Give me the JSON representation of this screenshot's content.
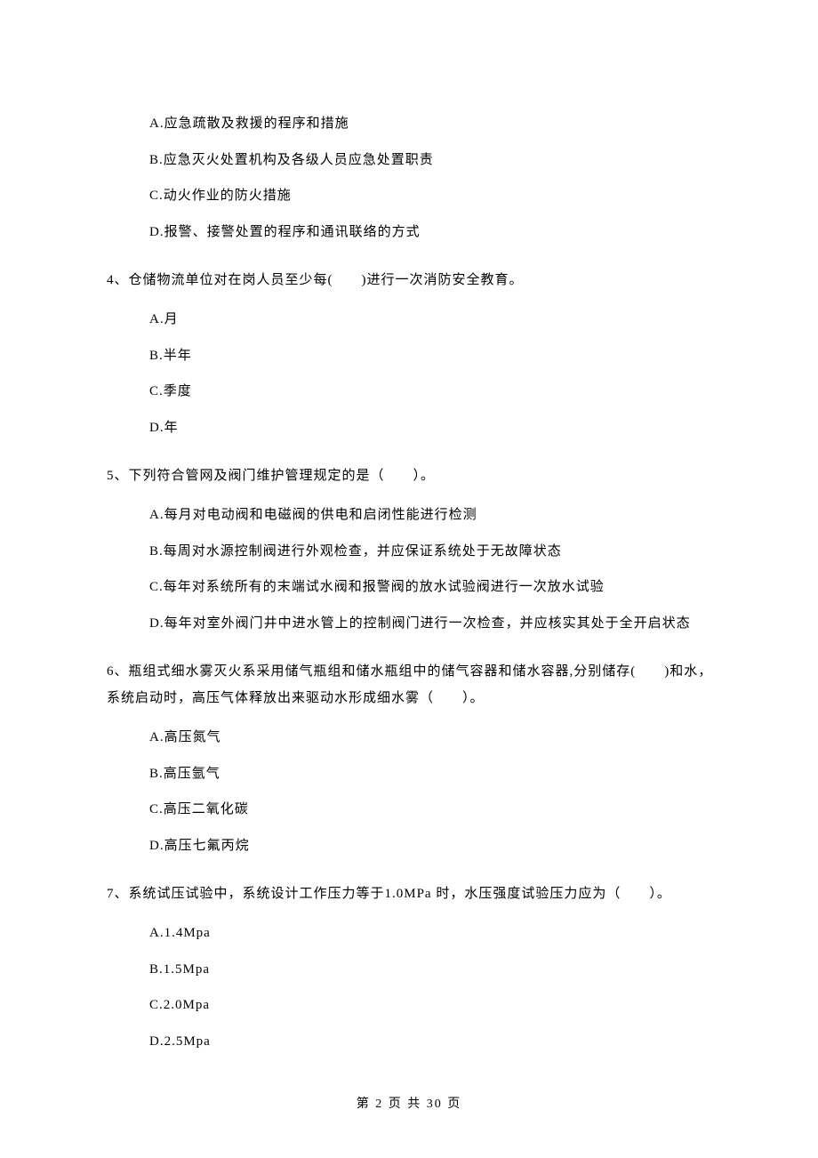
{
  "q3_options": {
    "A": "A.应急疏散及救援的程序和措施",
    "B": "B.应急灭火处置机构及各级人员应急处置职责",
    "C": "C.动火作业的防火措施",
    "D": "D.报警、接警处置的程序和通讯联络的方式"
  },
  "q4": {
    "stem": "4、仓储物流单位对在岗人员至少每(　　)进行一次消防安全教育。",
    "A": "A.月",
    "B": "B.半年",
    "C": "C.季度",
    "D": "D.年"
  },
  "q5": {
    "stem": "5、下列符合管网及阀门维护管理规定的是（　　）。",
    "A": "A.每月对电动阀和电磁阀的供电和启闭性能进行检测",
    "B": "B.每周对水源控制阀进行外观检查，并应保证系统处于无故障状态",
    "C": "C.每年对系统所有的末端试水阀和报警阀的放水试验阀进行一次放水试验",
    "D": "D.每年对室外阀门井中进水管上的控制阀门进行一次检查，并应核实其处于全开启状态"
  },
  "q6": {
    "stem": "6、瓶组式细水雾灭火系采用储气瓶组和储水瓶组中的储气容器和储水容器,分别储存(　　)和水，系统启动时，高压气体释放出来驱动水形成细水雾（　　）。",
    "A": "A.高压氮气",
    "B": "B.高压氩气",
    "C": "C.高压二氧化碳",
    "D": "D.高压七氟丙烷"
  },
  "q7": {
    "stem": "7、系统试压试验中，系统设计工作压力等于1.0MPa 时，水压强度试验压力应为（　　）。",
    "A": "A.1.4Mpa",
    "B": "B.1.5Mpa",
    "C": "C.2.0Mpa",
    "D": "D.2.5Mpa"
  },
  "footer": "第 2 页 共 30 页"
}
